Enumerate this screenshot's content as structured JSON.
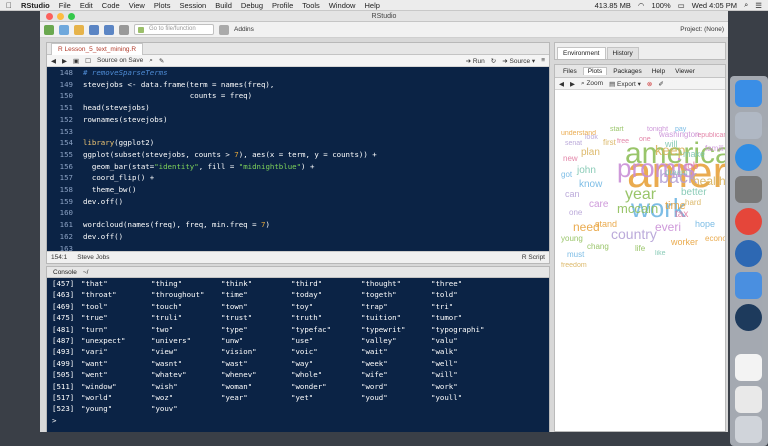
{
  "menubar": {
    "apple": "",
    "app": "RStudio",
    "items": [
      "File",
      "Edit",
      "Code",
      "View",
      "Plots",
      "Session",
      "Build",
      "Debug",
      "Profile",
      "Tools",
      "Window",
      "Help"
    ],
    "status": {
      "memory": "413.85 MB",
      "battery": "100%",
      "time": "Wed 4:05 PM"
    }
  },
  "window": {
    "title": "RStudio"
  },
  "toolbar": {
    "goto_placeholder": "Go to file/function",
    "addins": "Addins",
    "project": "Project: (None)"
  },
  "editor": {
    "tab": "R Lesson_5_text_mining.R",
    "source_on_save": "Source on Save",
    "run": "Run",
    "source": "Source",
    "status_pos": "154:1",
    "status_scope": "Steve Jobs",
    "status_type": "R Script",
    "line_numbers": [
      "148",
      "149",
      "150",
      "151",
      "152",
      "153",
      "154",
      "155",
      "156",
      "157",
      "158",
      "159",
      "160",
      "161",
      "162",
      "163"
    ]
  },
  "console": {
    "title": "Console",
    "path": "~/",
    "rows": [
      {
        "i": "[457]",
        "c": [
          "\"that\"",
          "\"thing\"",
          "\"think\"",
          "\"third\"",
          "\"thought\"",
          "\"three\""
        ]
      },
      {
        "i": "[463]",
        "c": [
          "\"throat\"",
          "\"throughout\"",
          "\"time\"",
          "\"today\"",
          "\"togeth\"",
          "\"told\""
        ]
      },
      {
        "i": "[469]",
        "c": [
          "\"tool\"",
          "\"touch\"",
          "\"town\"",
          "\"toy\"",
          "\"trap\"",
          "\"tri\""
        ]
      },
      {
        "i": "[475]",
        "c": [
          "\"true\"",
          "\"truli\"",
          "\"trust\"",
          "\"truth\"",
          "\"tuition\"",
          "\"tumor\""
        ]
      },
      {
        "i": "[481]",
        "c": [
          "\"turn\"",
          "\"two\"",
          "\"type\"",
          "\"typefac\"",
          "\"typewrit\"",
          "\"typographi\""
        ]
      },
      {
        "i": "[487]",
        "c": [
          "\"unexpect\"",
          "\"univers\"",
          "\"unw\"",
          "\"use\"",
          "\"valley\"",
          "\"valu\""
        ]
      },
      {
        "i": "[493]",
        "c": [
          "\"vari\"",
          "\"view\"",
          "\"vision\"",
          "\"voic\"",
          "\"wait\"",
          "\"walk\""
        ]
      },
      {
        "i": "[499]",
        "c": [
          "\"want\"",
          "\"wasnt\"",
          "\"wast\"",
          "\"way\"",
          "\"week\"",
          "\"well\""
        ]
      },
      {
        "i": "[505]",
        "c": [
          "\"went\"",
          "\"whatev\"",
          "\"whenev\"",
          "\"whole\"",
          "\"wife\"",
          "\"will\""
        ]
      },
      {
        "i": "[511]",
        "c": [
          "\"window\"",
          "\"wish\"",
          "\"woman\"",
          "\"wonder\"",
          "\"word\"",
          "\"work\""
        ]
      },
      {
        "i": "[517]",
        "c": [
          "\"world\"",
          "\"woz\"",
          "\"year\"",
          "\"yet\"",
          "\"youd\"",
          "\"youll\""
        ]
      },
      {
        "i": "[523]",
        "c": [
          "\"young\"",
          "\"youv\""
        ]
      }
    ],
    "prompt": ">"
  },
  "right_top_tabs": [
    "Environment",
    "History"
  ],
  "right_tabs": [
    "Files",
    "Plots",
    "Packages",
    "Help",
    "Viewer"
  ],
  "plot_tools": {
    "zoom": "Zoom",
    "export": "Export"
  },
  "wordcloud_words": [
    "understand",
    "start",
    "tonight",
    "pay",
    "republican",
    "senat",
    "first",
    "will",
    "american",
    "america",
    "promis",
    "work",
    "new",
    "country",
    "keep",
    "john",
    "need",
    "mccain",
    "care",
    "know",
    "job",
    "back",
    "plan",
    "make",
    "time",
    "year",
    "everi",
    "must",
    "tax",
    "can",
    "health",
    "better",
    "worker",
    "chang",
    "washington",
    "hope",
    "one",
    "one",
    "hard",
    "dream",
    "stand",
    "young",
    "famili",
    "got",
    "free",
    "look",
    "freedom",
    "like",
    "econom",
    "life"
  ],
  "colors": {
    "editor_bg": "#0b2345",
    "comment": "#4e8bd4",
    "string": "#7fd35a",
    "number": "#e6a83b"
  }
}
